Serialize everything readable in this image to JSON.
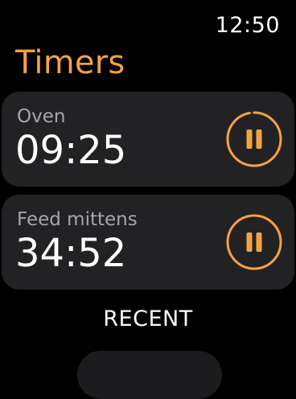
{
  "status": {
    "time": "12:50"
  },
  "header": {
    "title": "Timers"
  },
  "timers": [
    {
      "label": "Oven",
      "time": "09:25",
      "progress": 0.97,
      "accent": "#f3a243"
    },
    {
      "label": "Feed mittens",
      "time": "34:52",
      "progress": 0.99,
      "accent": "#f3a243"
    }
  ],
  "recent": {
    "label": "RECENT"
  },
  "colors": {
    "background": "#000000",
    "card": "#222224",
    "accent": "#f3a243",
    "label_gray": "#a6a6aa"
  }
}
